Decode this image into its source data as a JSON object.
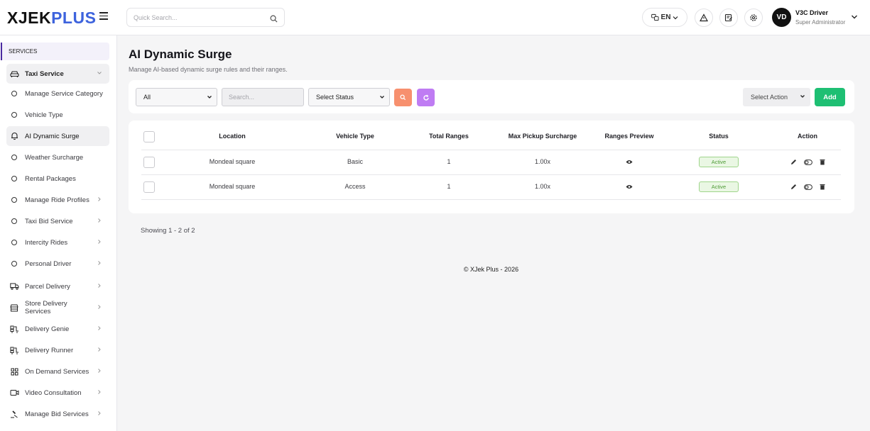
{
  "brand": {
    "logo_part1": "XJEK",
    "logo_part2": "PLUS",
    "accent": "#3d63dd"
  },
  "header": {
    "search_placeholder": "Quick Search...",
    "language": "EN",
    "user_initials": "VD",
    "user_name": "V3C Driver",
    "user_role": "Super Administrator",
    "icons": [
      "translate-icon",
      "alert-triangle-icon",
      "notes-icon",
      "settings-icon"
    ]
  },
  "sidebar": {
    "section": "SERVICES",
    "items": [
      {
        "label": "Taxi Service",
        "icon": "car-icon",
        "expanded": true
      },
      {
        "label": "Manage Service Category",
        "icon": "circle-icon"
      },
      {
        "label": "Vehicle Type",
        "icon": "circle-icon"
      },
      {
        "label": "AI Dynamic Surge",
        "icon": "bell-icon",
        "active": true
      },
      {
        "label": "Weather Surcharge",
        "icon": "circle-icon"
      },
      {
        "label": "Rental Packages",
        "icon": "circle-icon"
      },
      {
        "label": "Manage Ride Profiles",
        "icon": "circle-icon",
        "chevron": true
      },
      {
        "label": "Taxi Bid Service",
        "icon": "circle-icon",
        "chevron": true
      },
      {
        "label": "Intercity Rides",
        "icon": "circle-icon",
        "chevron": true
      },
      {
        "label": "Personal Driver",
        "icon": "circle-icon",
        "chevron": true
      },
      {
        "label": "Parcel Delivery",
        "icon": "truck-icon",
        "chevron": true
      },
      {
        "label": "Store Delivery Services",
        "icon": "store-icon",
        "chevron": true
      },
      {
        "label": "Delivery Genie",
        "icon": "delivery-icon",
        "chevron": true
      },
      {
        "label": "Delivery Runner",
        "icon": "delivery-icon",
        "chevron": true
      },
      {
        "label": "On Demand Services",
        "icon": "grid-icon",
        "chevron": true
      },
      {
        "label": "Video Consultation",
        "icon": "video-icon",
        "chevron": true
      },
      {
        "label": "Manage Bid Services",
        "icon": "gavel-icon",
        "chevron": true
      }
    ]
  },
  "page": {
    "title": "AI Dynamic Surge",
    "subtitle": "Manage AI-based dynamic surge rules and their ranges."
  },
  "filters": {
    "location_select": "All",
    "search_placeholder": "Search...",
    "status_select": "Select Status",
    "action_select": "Select Action",
    "add_label": "Add",
    "search_btn_color": "#f7906e",
    "reset_btn_color": "#bf7cf3"
  },
  "table": {
    "columns": [
      "Location",
      "Vehicle Type",
      "Total Ranges",
      "Max Pickup Surcharge",
      "Ranges Preview",
      "Status",
      "Action"
    ],
    "rows": [
      {
        "location": "Mondeal square",
        "vehicle_type": "Basic",
        "total_ranges": "1",
        "max_pickup": "1.00x",
        "status": "Active"
      },
      {
        "location": "Mondeal square",
        "vehicle_type": "Access",
        "total_ranges": "1",
        "max_pickup": "1.00x",
        "status": "Active"
      }
    ]
  },
  "pagination": {
    "showing": "Showing 1 - 2 of 2"
  },
  "footer": {
    "copyright": "© XJek Plus - 2026"
  }
}
